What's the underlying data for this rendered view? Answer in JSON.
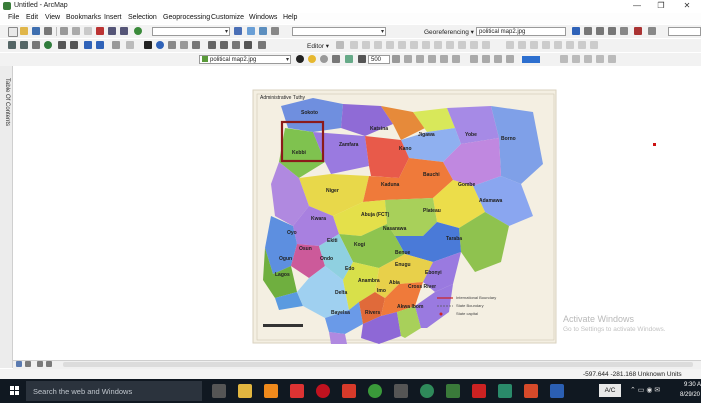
{
  "window": {
    "title": "Untitled - ArcMap",
    "min": "—",
    "max": "❐",
    "close": "✕"
  },
  "menu": [
    "File",
    "Edit",
    "View",
    "Bookmarks",
    "Insert",
    "Selection",
    "Geoprocessing",
    "Customize",
    "Windows",
    "Help"
  ],
  "georef": {
    "label": "Georeferencing ▾",
    "layer": "political map2.jpg"
  },
  "editor": {
    "label": "Editor ▾"
  },
  "toolbar3": {
    "layer": "political map2.jpg",
    "opacity": "500"
  },
  "toc": {
    "label": "Table Of Contents"
  },
  "map": {
    "header": "Administrative Tuthy",
    "states": [
      "Sokoto",
      "Katsina",
      "Jigawa",
      "Yobe",
      "Borno",
      "Kebbi",
      "Zamfara",
      "Kano",
      "Bauchi",
      "Gombe",
      "Adamawa",
      "Niger",
      "Kaduna",
      "Plateau",
      "Taraba",
      "Kwara",
      "Abuja (FCT)",
      "Nasarawa",
      "Benue",
      "Oyo",
      "Ekiti",
      "Kogi",
      "Ogun",
      "Osun",
      "Ondo",
      "Edo",
      "Enugu",
      "Ebonyi",
      "Cross River",
      "Lagos",
      "Delta",
      "Anambra",
      "Imo",
      "Abia",
      "Bayelsa",
      "Rivers",
      "Akwa Ibom"
    ],
    "legend": [
      "International Boundary",
      "State Boundary",
      "State capital"
    ]
  },
  "watermark": {
    "line1": "Activate Windows",
    "line2": "Go to Settings to activate Windows."
  },
  "status": {
    "coords": "-597.644  -281.168 Unknown Units"
  },
  "taskbar": {
    "search": "Search the web and Windows",
    "ac": "A/C",
    "time": "9:30 A",
    "date": "8/29/20"
  },
  "colors": {
    "taskbar": "#101821",
    "map_bg": "#f4efe2",
    "highlight": "#8b1a1a"
  }
}
